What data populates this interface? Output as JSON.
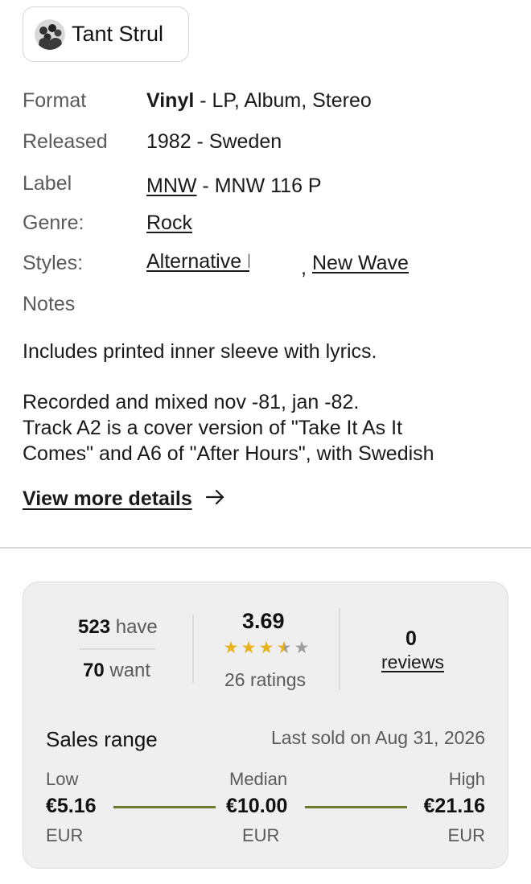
{
  "artist": {
    "name": "Tant Strul",
    "avatar_icon": "band-photo-avatar"
  },
  "details": {
    "format": {
      "key": "Format",
      "value_bold": "Vinyl",
      "value_rest": " - LP, Album, Stereo"
    },
    "released": {
      "key": "Released",
      "value": "1982 - Sweden"
    },
    "label": {
      "key": "Label",
      "link": "MNW",
      "rest": " - MNW 116 P"
    },
    "genre": {
      "key": "Genre:",
      "link": "Rock"
    },
    "styles": {
      "key": "Styles:",
      "items": [
        "Alternative Rock",
        "New Wave"
      ],
      "separator": ","
    },
    "notes": {
      "key": "Notes"
    }
  },
  "notes_text": {
    "line1": "Includes printed inner sleeve with lyrics.",
    "line2": "Recorded and mixed nov -81, jan -82.",
    "line3": "Track A2 is a cover version of \"Take It As It",
    "line4": "Comes\" and A6 of \"After Hours\", with Swedish"
  },
  "view_more": {
    "label": "View more details",
    "icon": "arrow-right-icon"
  },
  "stats": {
    "have": {
      "count": "523",
      "label": "have"
    },
    "want": {
      "count": "70",
      "label": "want"
    },
    "rating": {
      "average": "3.69",
      "average_value": 3.69,
      "stars_max": 5,
      "count_label": "26 ratings"
    },
    "reviews": {
      "count": "0",
      "label": "reviews"
    }
  },
  "sales": {
    "title": "Sales range",
    "last_sold": "Last sold on Aug 31, 2026",
    "low": {
      "label": "Low",
      "price": "€5.16",
      "currency": "EUR"
    },
    "median": {
      "label": "Median",
      "price": "€10.00",
      "currency": "EUR"
    },
    "high": {
      "label": "High",
      "price": "€21.16",
      "currency": "EUR"
    },
    "line_color": "#6b7a2d"
  },
  "colors": {
    "star": "#e8b21e",
    "star_empty": "#9d9d9d"
  }
}
